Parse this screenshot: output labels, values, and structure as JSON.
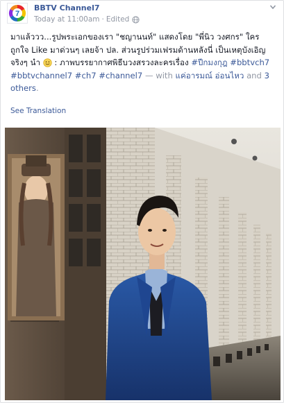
{
  "post": {
    "page_name": "BBTV Channel7",
    "timestamp": "Today at 11:00am",
    "edited_label": "Edited",
    "caption": {
      "line_text": "มาแล้ววว...รูปพระเอกของเรา \"ชญานนท์\" แสดงโดย \"พี่นิว วงศกร\" ใครถูกใจ Like มาด่วนๆ เลยจ้า ปล. ส่วนรูปร่วมเฟรมด้านหลังนี่ เป็นเหตุบังเอิญจริงๆ นำ",
      "after_emoji": " : ภาพบรรยากาศพิธีบวงสรวงละครเรื่อง ",
      "hashtags": [
        "#ปีกมงกุฎ",
        "#bbtvch7",
        "#bbtvchannel7",
        "#ch7",
        "#channel7"
      ],
      "with_text": "— with",
      "tagged_person": "แค่อารมณ์ อ่อนไหว",
      "and_text": "and",
      "others_link": "3 others",
      "end_period": "."
    },
    "see_translation": "See Translation"
  },
  "colors": {
    "link": "#3b5998",
    "muted": "#9197a3",
    "text": "#141823",
    "logo_red": "#e8262a",
    "logo_green": "#3aaa35",
    "logo_blue": "#1f6fc1",
    "logo_yellow": "#f5c400"
  },
  "icons": {
    "avatar": "ch7-logo-icon",
    "globe": "globe-icon",
    "menu": "chevron-down-icon",
    "emoji": "smile-emoji-icon"
  }
}
